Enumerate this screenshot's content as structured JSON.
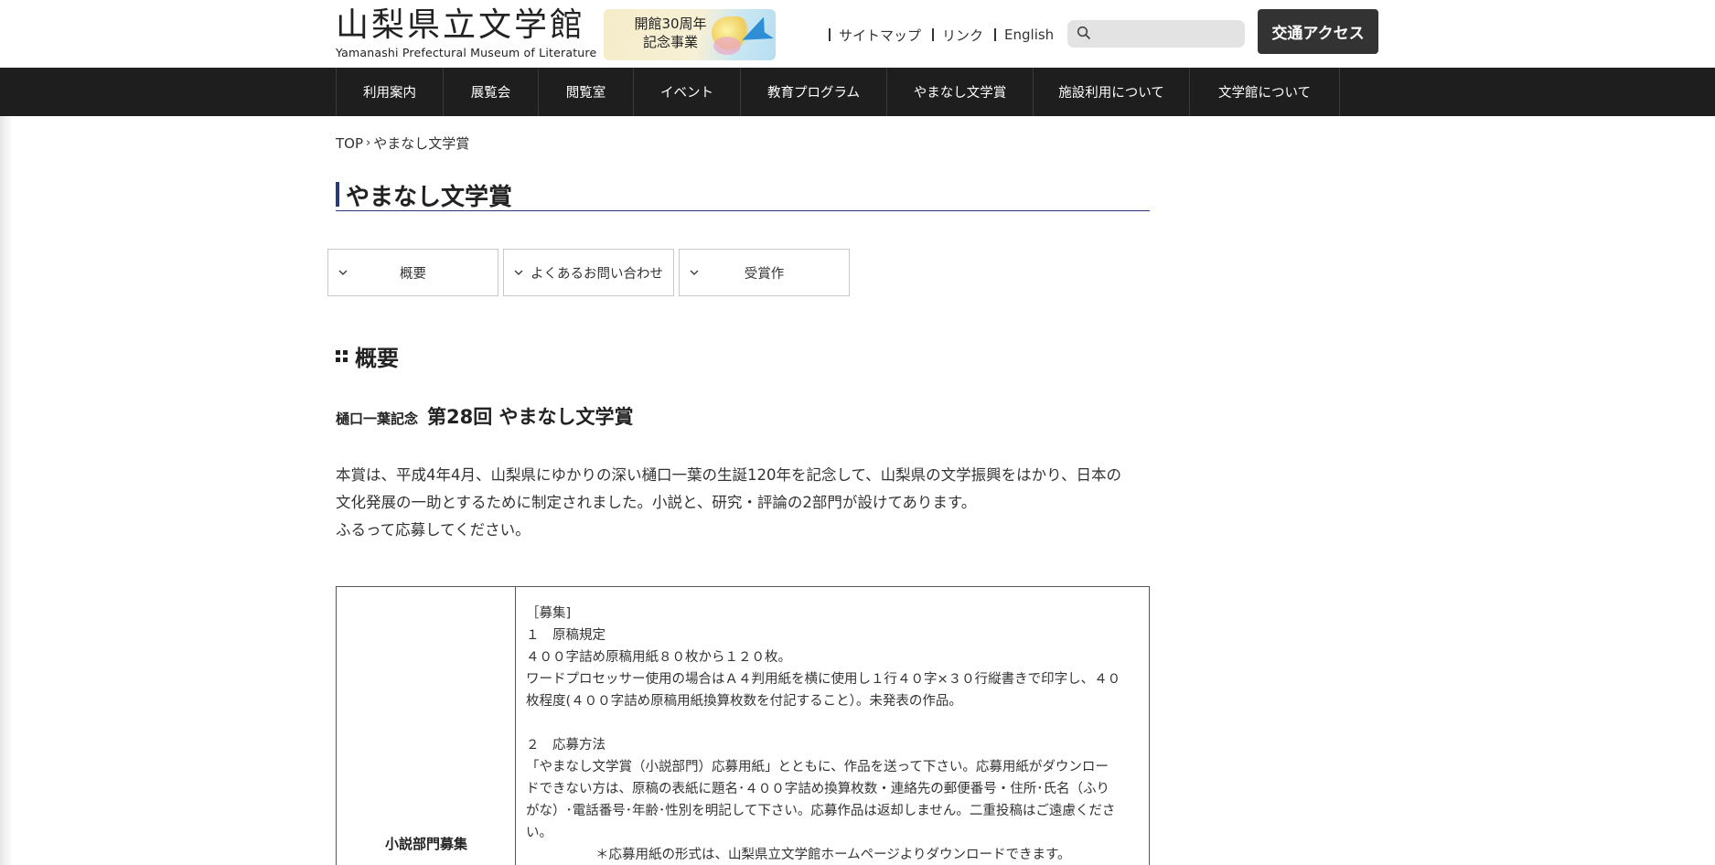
{
  "header": {
    "logo_jp": "山梨県立文学館",
    "logo_en": "Yamanashi Prefectural Museum of Literature",
    "anniversary_line1": "開館30周年",
    "anniversary_line2": "記念事業",
    "util_links": [
      "サイトマップ",
      "リンク",
      "English"
    ],
    "search_placeholder": "",
    "access_button": "交通アクセス"
  },
  "nav": {
    "items": [
      "利用案内",
      "展覧会",
      "閲覧室",
      "イベント",
      "教育プログラム",
      "やまなし文学賞",
      "施設利用について",
      "文学館について"
    ]
  },
  "breadcrumb": {
    "home": "TOP",
    "separator": "›",
    "current": "やまなし文学賞"
  },
  "page_title": "やまなし文学賞",
  "tabs": [
    "概要",
    "よくあるお問い合わせ",
    "受賞作"
  ],
  "section": {
    "heading": "概要",
    "award_prefix": "樋口一葉記念",
    "award_title": "第28回 やまなし文学賞",
    "intro_lines": [
      "本賞は、平成4年4月、山梨県にゆかりの深い樋口一葉の生誕120年を記念して、山梨県の文学振興をはかり、日本の",
      "文化発展の一助とするために制定されました。小説と、研究・評論の2部門が設けてあります。",
      "ふるって応募してください。"
    ]
  },
  "table": {
    "header_label": "小説部門募集",
    "lines": [
      "［募集]",
      "１　原稿規定",
      "４００字詰め原稿用紙８０枚から１２０枚。",
      "ワードプロセッサー使用の場合はＡ４判用紙を横に使用し１行４０字×３０行縦書きで印字し、４０",
      "枚程度(４００字詰め原稿用紙換算枚数を付記すること）。未発表の作品。",
      "",
      "２　応募方法",
      "「やまなし文学賞（小説部門）応募用紙」とともに、作品を送って下さい。応募用紙がダウンロー",
      "ドできない方は、原稿の表紙に題名･４００字詰め換算枚数・連絡先の郵便番号・住所･氏名（ふり",
      "がな）･電話番号･年齢･性別を明記して下さい。応募作品は返却しません。二重投稿はご遠慮くださ",
      "い。"
    ],
    "note": "＊応募用紙の形式は、山梨県立文学館ホームページよりダウンロードできます。"
  },
  "colors": {
    "nav_bg": "#1e1e1e",
    "accent": "#2b3a78",
    "access_btn_bg": "#333333"
  }
}
